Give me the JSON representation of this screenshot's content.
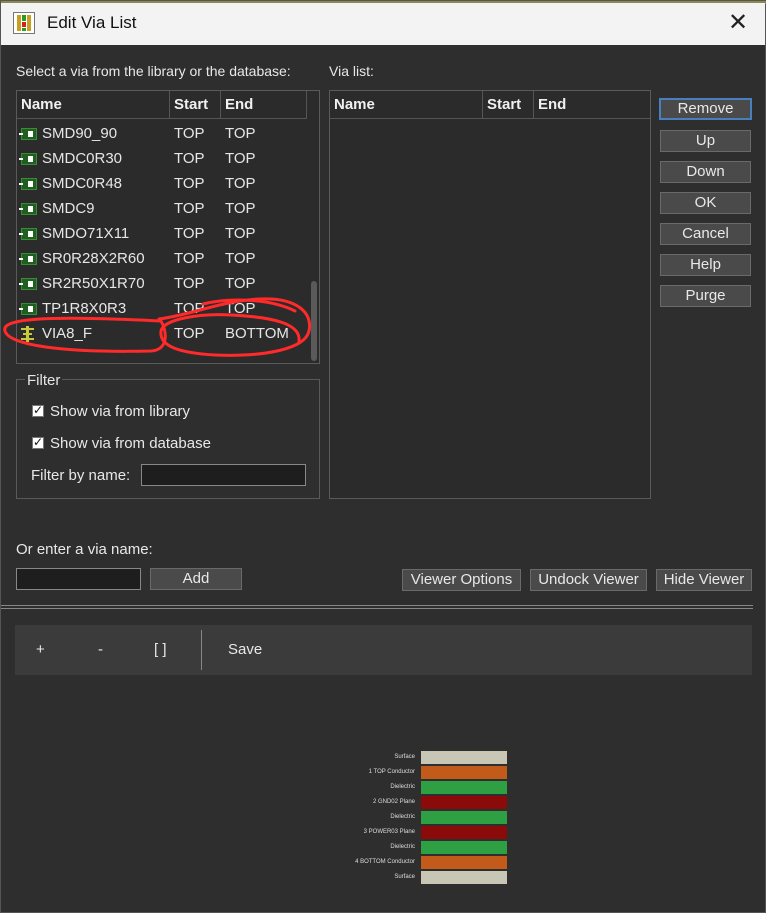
{
  "window": {
    "title": "Edit Via List",
    "close_glyph": "✕"
  },
  "library": {
    "label": "Select a via from the library or the database:",
    "columns": [
      "Name",
      "Start",
      "End"
    ],
    "rows": [
      {
        "name": "SMD90_90",
        "start": "TOP",
        "end": "TOP"
      },
      {
        "name": "SMDC0R30",
        "start": "TOP",
        "end": "TOP"
      },
      {
        "name": "SMDC0R48",
        "start": "TOP",
        "end": "TOP"
      },
      {
        "name": "SMDC9",
        "start": "TOP",
        "end": "TOP"
      },
      {
        "name": "SMDO71X11",
        "start": "TOP",
        "end": "TOP"
      },
      {
        "name": "SR0R28X2R60",
        "start": "TOP",
        "end": "TOP"
      },
      {
        "name": "SR2R50X1R70",
        "start": "TOP",
        "end": "TOP"
      },
      {
        "name": "TP1R8X0R3",
        "start": "TOP",
        "end": "TOP"
      },
      {
        "name": "VIA8_F",
        "start": "TOP",
        "end": "BOTTOM"
      }
    ]
  },
  "via_list": {
    "label": "Via list:",
    "columns": [
      "Name",
      "Start",
      "End"
    ]
  },
  "side_buttons": [
    "Remove",
    "Up",
    "Down",
    "OK",
    "Cancel",
    "Help",
    "Purge"
  ],
  "filter": {
    "legend": "Filter",
    "show_library": "Show via from library",
    "show_database": "Show via from database",
    "by_name_label": "Filter by name:",
    "by_name_value": ""
  },
  "enter_via": {
    "label": "Or enter a via name:",
    "value": "",
    "add_button": "Add"
  },
  "viewer_buttons": {
    "options": "Viewer Options",
    "undock": "Undock Viewer",
    "hide": "Hide Viewer"
  },
  "viewer_toolbar": {
    "zoom_in": "+",
    "zoom_out": "-",
    "fit": "[ ]",
    "save": "Save"
  },
  "stackup": [
    {
      "label": "Surface",
      "color": "#c8c6b4"
    },
    {
      "label": "1    TOP Conductor",
      "color": "#c25a1a"
    },
    {
      "label": "Dielectric",
      "color": "#2ea043"
    },
    {
      "label": "2    GND02 Plane",
      "color": "#8b0a0a"
    },
    {
      "label": "Dielectric",
      "color": "#2ea043"
    },
    {
      "label": "3    POWER03 Plane",
      "color": "#8b0a0a"
    },
    {
      "label": "Dielectric",
      "color": "#2ea043"
    },
    {
      "label": "4    BOTTOM Conductor",
      "color": "#c25a1a"
    },
    {
      "label": "Surface",
      "color": "#c8c6b4"
    }
  ],
  "colors": {
    "annotation": "#ff2a2a",
    "focus_border": "#4a7fbf"
  }
}
